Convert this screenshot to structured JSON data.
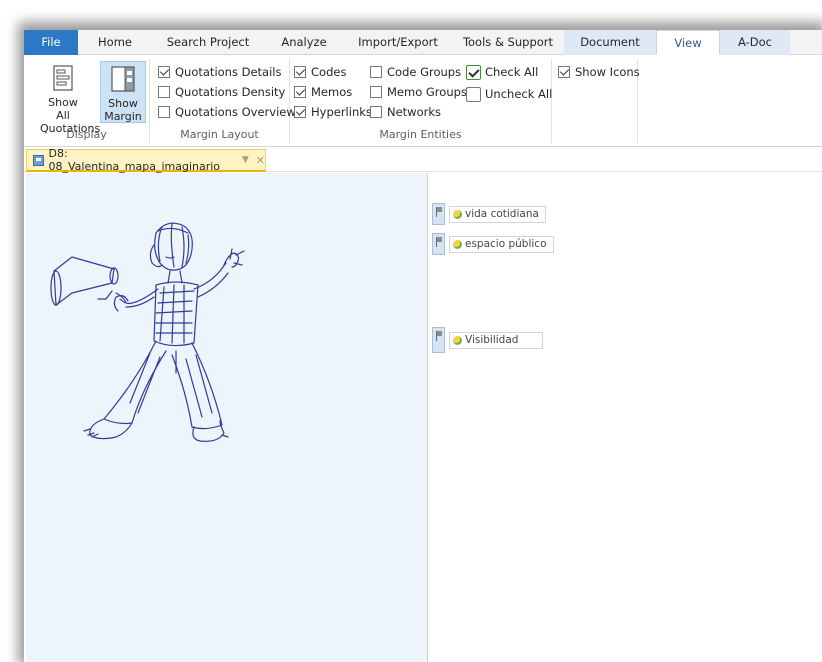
{
  "ribbon": {
    "tabs": [
      "File",
      "Home",
      "Search Project",
      "Analyze",
      "Import/Export",
      "Tools & Support",
      "Document",
      "View",
      "A-Doc"
    ],
    "active_tab": "View",
    "display": {
      "label": "Display",
      "show_all_quotations": "Show All Quotations",
      "show_margin": "Show Margin"
    },
    "margin_layout": {
      "label": "Margin Layout",
      "quotations_details": "Quotations Details",
      "quotations_density": "Quotations Density",
      "quotations_overview": "Quotations Overview"
    },
    "margin_entities": {
      "label": "Margin Entities",
      "codes": "Codes",
      "memos": "Memos",
      "hyperlinks": "Hyperlinks",
      "code_groups": "Code Groups",
      "memo_groups": "Memo Groups",
      "networks": "Networks",
      "check_all": "Check All",
      "uncheck_all": "Uncheck All"
    },
    "show_icons": "Show Icons"
  },
  "document": {
    "tab_title": "D8: 08_Valentina_mapa_imaginario"
  },
  "margin_codes": [
    {
      "label": "vida cotidiana"
    },
    {
      "label": "espacio público"
    },
    {
      "label": "Visibilidad"
    }
  ],
  "colors": {
    "file_tab": "#2b78c4",
    "context_tab": "#dfe9f5",
    "active_button": "#cde2f5",
    "doc_tab": "#fff3c4",
    "sketch_ink": "#2c3d9a"
  }
}
